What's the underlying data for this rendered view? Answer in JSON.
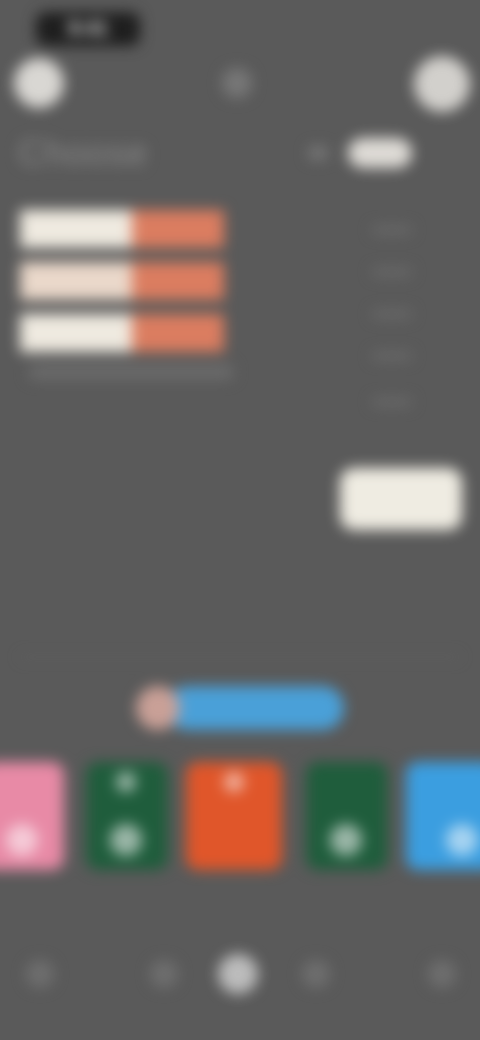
{
  "status": {
    "time": "9:41"
  },
  "header": {
    "title": "Choose"
  },
  "rows": [
    {
      "label": "",
      "value": ""
    },
    {
      "label": "",
      "value": ""
    },
    {
      "label": "",
      "value": ""
    }
  ],
  "footnote": "",
  "selector": {
    "top_label": "",
    "button_label": ""
  },
  "progress": {
    "label": "",
    "value_fraction": 0.85
  },
  "tiles": [
    {
      "label": "",
      "color": "#e88aa6"
    },
    {
      "label": "",
      "color": "#1f5d3c"
    },
    {
      "label": "",
      "color": "#e0562a"
    },
    {
      "label": "",
      "color": "#1f5d3c"
    },
    {
      "label": "",
      "color": "#3b9ee0"
    }
  ],
  "section_label": "",
  "icons": {
    "back": "back-icon",
    "center": "app-icon",
    "menu": "menu-icon"
  },
  "nav": {
    "items": [
      "home-icon",
      "search-icon",
      "center-icon",
      "bell-icon",
      "profile-icon"
    ],
    "active_index": 2
  },
  "colors": {
    "background": "#5a5a5a",
    "accent": "#db7d60",
    "progress": "#4aa0d8"
  }
}
